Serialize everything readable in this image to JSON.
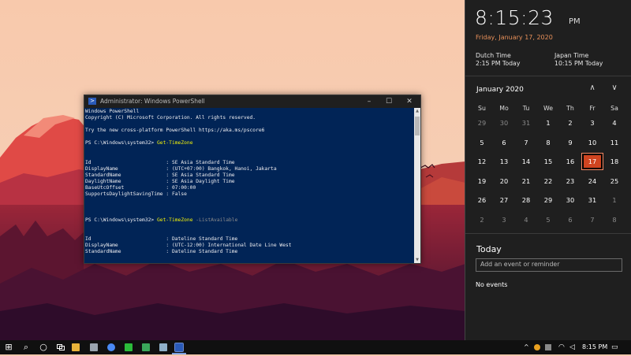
{
  "powershell": {
    "title": "Administrator: Windows PowerShell",
    "controls": [
      "–",
      "☐",
      "✕"
    ],
    "lines": [
      [
        {
          "t": "Windows PowerShell"
        }
      ],
      [
        {
          "t": "Copyright (C) Microsoft Corporation. All rights reserved."
        }
      ],
      [
        {
          "t": ""
        }
      ],
      [
        {
          "t": "Try the new cross-platform PowerShell https://aka.ms/pscore6"
        }
      ],
      [
        {
          "t": ""
        }
      ],
      [
        {
          "t": "PS C:\\Windows\\system32> "
        },
        {
          "t": "Get-TimeZone",
          "c": "cmd"
        }
      ],
      [
        {
          "t": ""
        }
      ],
      [
        {
          "t": ""
        }
      ],
      [
        {
          "t": "Id                         : SE Asia Standard Time"
        }
      ],
      [
        {
          "t": "DisplayName                : (UTC+07:00) Bangkok, Hanoi, Jakarta"
        }
      ],
      [
        {
          "t": "StandardName               : SE Asia Standard Time"
        }
      ],
      [
        {
          "t": "DaylightName               : SE Asia Daylight Time"
        }
      ],
      [
        {
          "t": "BaseUtcOffset              : 07:00:00"
        }
      ],
      [
        {
          "t": "SupportsDaylightSavingTime : False"
        }
      ],
      [
        {
          "t": ""
        }
      ],
      [
        {
          "t": ""
        }
      ],
      [
        {
          "t": ""
        }
      ],
      [
        {
          "t": "PS C:\\Windows\\system32> "
        },
        {
          "t": "Get-TimeZone",
          "c": "cmd"
        },
        {
          "t": " -ListAvailable",
          "c": "param"
        }
      ],
      [
        {
          "t": ""
        }
      ],
      [
        {
          "t": ""
        }
      ],
      [
        {
          "t": "Id                         : Dateline Standard Time"
        }
      ],
      [
        {
          "t": "DisplayName                : (UTC-12:00) International Date Line West"
        }
      ],
      [
        {
          "t": "StandardName               : Dateline Standard Time"
        }
      ]
    ]
  },
  "flyout": {
    "time": "8:15:23",
    "ampm": "PM",
    "date": "Friday, January 17, 2020",
    "zones": [
      {
        "name": "Dutch Time",
        "value": "2:15 PM Today"
      },
      {
        "name": "Japan Time",
        "value": "10:15 PM Today"
      }
    ],
    "month": "January 2020",
    "nav_prev": "∧",
    "nav_next": "∨",
    "weekdays": [
      "Su",
      "Mo",
      "Tu",
      "We",
      "Th",
      "Fr",
      "Sa"
    ],
    "days": [
      [
        "29",
        "30",
        "31",
        "1",
        "2",
        "3",
        "4"
      ],
      [
        "5",
        "6",
        "7",
        "8",
        "9",
        "10",
        "11"
      ],
      [
        "12",
        "13",
        "14",
        "15",
        "16",
        "17",
        "18"
      ],
      [
        "19",
        "20",
        "21",
        "22",
        "23",
        "24",
        "25"
      ],
      [
        "26",
        "27",
        "28",
        "29",
        "30",
        "31",
        "1"
      ],
      [
        "2",
        "3",
        "4",
        "5",
        "6",
        "7",
        "8"
      ]
    ],
    "today_label": "Today",
    "event_placeholder": "Add an event or reminder",
    "no_events": "No events"
  },
  "taskbar": {
    "start": "⊞",
    "search_icon": "⌕",
    "cortana_icon": "○",
    "tray_time": "8:15 PM",
    "tray_up": "^",
    "notifications": "▭",
    "accent": "#cf4420"
  }
}
